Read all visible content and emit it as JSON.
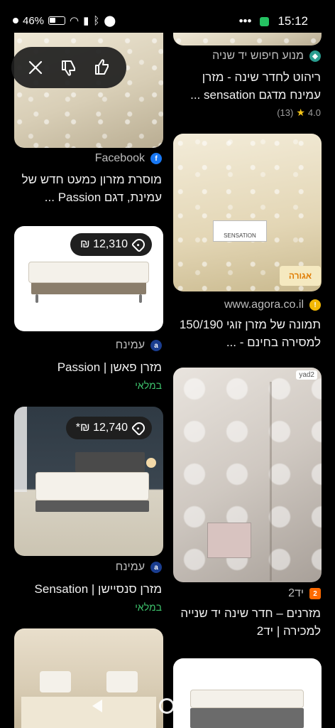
{
  "status_bar": {
    "battery": "46%",
    "time": "15:12"
  },
  "feedback": {
    "close_icon": "close-icon",
    "dislike_icon": "thumbs-down-icon",
    "like_icon": "thumbs-up-icon"
  },
  "left_column": [
    {
      "source": "Facebook",
      "title": "מוסרת מזרון כמעט חדש של עמינת, דגם Passion ..."
    },
    {
      "price": "12,310 ₪",
      "source": "עמינח",
      "title": "מזרן פאשן | Passion",
      "stock": "במלאי"
    },
    {
      "price": "12,740 ₪*",
      "source": "עמינח",
      "title": "מזרן סנסיישן | Sensation",
      "stock": "במלאי"
    }
  ],
  "right_column": [
    {
      "source": "מנוע חיפוש יד שניה",
      "title": "ריהוט לחדר שינה - מזרן עמינח מדגם sensation ...",
      "rating": "4.0",
      "reviews": "(13)"
    },
    {
      "source": "www.agora.co.il",
      "title": "תמונה של מזרן זוגי 150/190 למסירה בחינם - ..."
    },
    {
      "source": "יד2",
      "title": "מזרנים – חדר שינה יד שנייה למכירה | יד2"
    }
  ],
  "image_text": {
    "label_sensation": "SENSATION",
    "label_agora": "אגורה",
    "yad2_mark": "yad2"
  },
  "colors": {
    "background": "#000000",
    "in_stock": "#3ec46d",
    "star": "#f5c518"
  }
}
